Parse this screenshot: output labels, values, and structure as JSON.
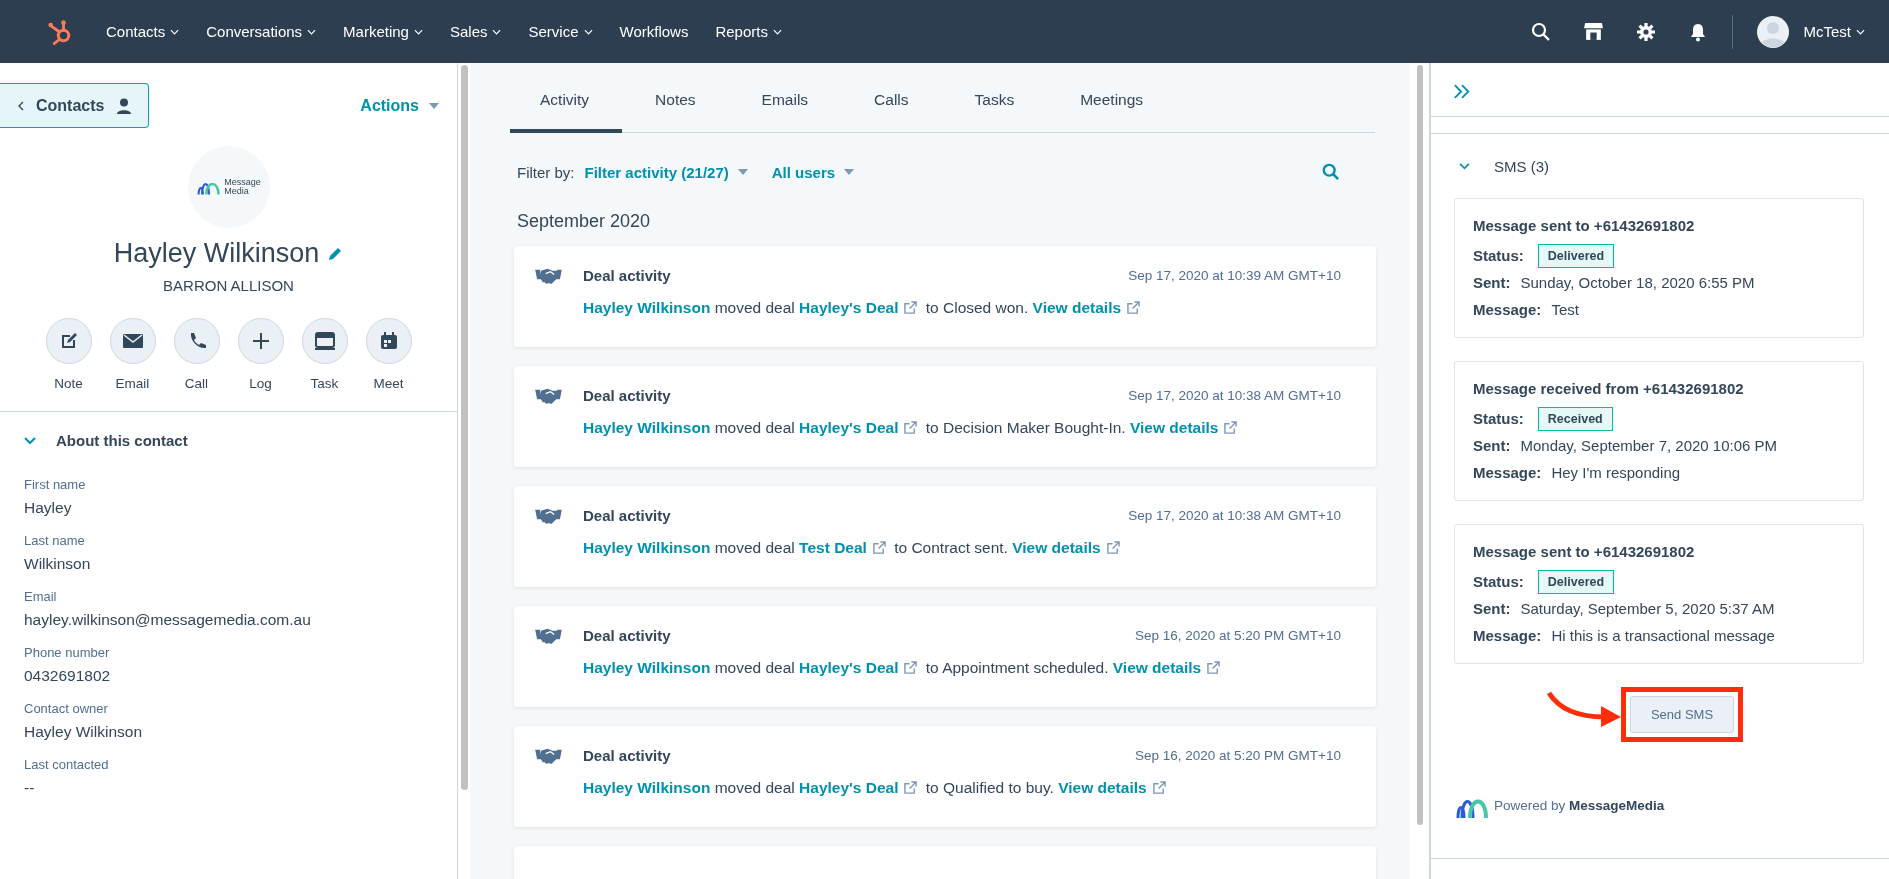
{
  "nav": {
    "items": [
      {
        "label": "Contacts",
        "has_caret": true
      },
      {
        "label": "Conversations",
        "has_caret": true
      },
      {
        "label": "Marketing",
        "has_caret": true
      },
      {
        "label": "Sales",
        "has_caret": true
      },
      {
        "label": "Service",
        "has_caret": true
      },
      {
        "label": "Workflows",
        "has_caret": false
      },
      {
        "label": "Reports",
        "has_caret": true
      }
    ],
    "user_name": "McTest"
  },
  "contact": {
    "back_button": "Contacts",
    "actions": "Actions",
    "logo_lines": [
      "Message",
      "Media"
    ],
    "name": "Hayley Wilkinson",
    "company": "BARRON ALLISON",
    "quick_actions": [
      {
        "kind": "note",
        "label": "Note"
      },
      {
        "kind": "email",
        "label": "Email"
      },
      {
        "kind": "call",
        "label": "Call"
      },
      {
        "kind": "log",
        "label": "Log"
      },
      {
        "kind": "task",
        "label": "Task"
      },
      {
        "kind": "meet",
        "label": "Meet"
      }
    ],
    "about": {
      "title": "About this contact",
      "expanded": true,
      "fields": [
        {
          "label": "First name",
          "value": "Hayley"
        },
        {
          "label": "Last name",
          "value": "Wilkinson"
        },
        {
          "label": "Email",
          "value": "hayley.wilkinson@messagemedia.com.au"
        },
        {
          "label": "Phone number",
          "value": "0432691802"
        },
        {
          "label": "Contact owner",
          "value": "Hayley Wilkinson"
        },
        {
          "label": "Last contacted",
          "value": "--"
        }
      ]
    }
  },
  "timeline": {
    "tabs": [
      {
        "label": "Activity",
        "selected": true
      },
      {
        "label": "Notes",
        "selected": false
      },
      {
        "label": "Emails",
        "selected": false
      },
      {
        "label": "Calls",
        "selected": false
      },
      {
        "label": "Tasks",
        "selected": false
      },
      {
        "label": "Meetings",
        "selected": false
      }
    ],
    "filter_label": "Filter by:",
    "filters": [
      "Filter activity (21/27)",
      "All users"
    ],
    "month": "September 2020",
    "activities": [
      {
        "title": "Deal activity",
        "time": "Sep 17, 2020 at 10:39 AM GMT+10",
        "actor": "Hayley Wilkinson",
        "verb": "moved deal",
        "deal": "Hayley's Deal",
        "result": "to Closed won.",
        "link": "View details"
      },
      {
        "title": "Deal activity",
        "time": "Sep 17, 2020 at 10:38 AM GMT+10",
        "actor": "Hayley Wilkinson",
        "verb": "moved deal",
        "deal": "Hayley's Deal",
        "result": "to Decision Maker Bought-In.",
        "link": "View details"
      },
      {
        "title": "Deal activity",
        "time": "Sep 17, 2020 at 10:38 AM GMT+10",
        "actor": "Hayley Wilkinson",
        "verb": "moved deal",
        "deal": "Test Deal",
        "result": "to Contract sent.",
        "link": "View details"
      },
      {
        "title": "Deal activity",
        "time": "Sep 16, 2020 at 5:20 PM GMT+10",
        "actor": "Hayley Wilkinson",
        "verb": "moved deal",
        "deal": "Hayley's Deal",
        "result": "to Appointment scheduled.",
        "link": "View details"
      },
      {
        "title": "Deal activity",
        "time": "Sep 16, 2020 at 5:20 PM GMT+10",
        "actor": "Hayley Wilkinson",
        "verb": "moved deal",
        "deal": "Hayley's Deal",
        "result": "to Qualified to buy.",
        "link": "View details"
      }
    ]
  },
  "sms": {
    "title": "SMS (3)",
    "expanded": true,
    "messages": [
      {
        "heading": "Message sent to +61432691802",
        "status_label": "Status:",
        "status": "Delivered",
        "sent_label": "Sent:",
        "sent": "Sunday, October 18, 2020 6:55 PM",
        "message_label": "Message:",
        "message": "Test"
      },
      {
        "heading": "Message received from +61432691802",
        "status_label": "Status:",
        "status": "Received",
        "sent_label": "Sent:",
        "sent": "Monday, September 7, 2020 10:06 PM",
        "message_label": "Message:",
        "message": "Hey I'm responding"
      },
      {
        "heading": "Message sent to +61432691802",
        "status_label": "Status:",
        "status": "Delivered",
        "sent_label": "Sent:",
        "sent": "Saturday, September 5, 2020 5:37 AM",
        "message_label": "Message:",
        "message": "Hi this is a transactional message"
      }
    ],
    "send_button": "Send SMS",
    "highlighted": true,
    "powered_by": "Powered by **MessageMedia**"
  }
}
